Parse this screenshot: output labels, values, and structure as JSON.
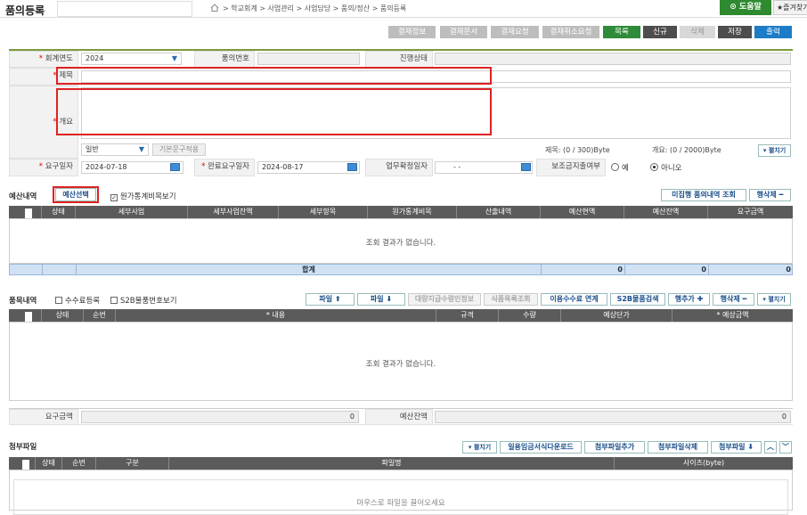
{
  "header": {
    "title": "품의등록",
    "breadcrumb": "> 학교회계 > 사업관리 > 사업담당 > 품의/정산 > 품의등록",
    "help_label": "도움말",
    "favorite_label": "즐겨찾기"
  },
  "toolbar": {
    "buttons": [
      "결재정보",
      "결재문서",
      "결재요청",
      "결재취소요청",
      "목록",
      "신규",
      "삭제",
      "저장",
      "출력"
    ]
  },
  "form": {
    "fiscal_year_label": "회계연도",
    "fiscal_year_value": "2024",
    "approval_no_label": "품의번호",
    "approval_no_value": "",
    "progress_label": "진행상태",
    "progress_value": "",
    "subject_label": "제목",
    "subject_value": "",
    "summary_label": "개요",
    "summary_value": "",
    "type_value": "일반",
    "template_btn": "기본문구적용",
    "subject_count": "제목: (0 / 300)Byte",
    "summary_count": "개요: (0 / 2000)Byte",
    "expand_label": "펼치기",
    "request_date_label": "요구일자",
    "request_date_value": "2024-07-18",
    "completion_date_label": "완료요구일자",
    "completion_date_value": "2024-08-17",
    "confirm_date_label": "업무확정일자",
    "confirm_date_value": "- -",
    "subsidy_label": "보조금지출여부",
    "subsidy_yes": "예",
    "subsidy_no": "아니오"
  },
  "budget": {
    "title": "예산내역",
    "select_btn": "예산선택",
    "stats_check": "원가통계비목보기",
    "unexec_btn": "미집행 품의내역 조회",
    "delete_row_btn": "행삭제 ━",
    "columns": [
      "상태",
      "세부사업",
      "세부사업잔액",
      "세부항목",
      "원가통계비목",
      "산출내역",
      "예산현액",
      "예산잔액",
      "요구금액"
    ],
    "empty_msg": "조회 결과가 없습니다.",
    "total_label": "합계",
    "totals": [
      "0",
      "0",
      "0"
    ]
  },
  "items": {
    "title": "품목내역",
    "fee_check": "수수료등록",
    "s2b_check": "S2B물품번호보기",
    "buttons": [
      "파일 ⬆",
      "파일 ⬇",
      "대량지급수령인정보",
      "식품목록조회",
      "이용수수료 연계",
      "S2B물품검색",
      "행추가 ✚",
      "행삭제 ━",
      "펼치기"
    ],
    "columns": [
      "상태",
      "순번",
      "* 내용",
      "규격",
      "수량",
      "예상단가",
      "* 예상금액"
    ],
    "empty_msg": "조회 결과가 없습니다."
  },
  "amounts": {
    "request_label": "요구금액",
    "request_value": "0",
    "balance_label": "예산잔액",
    "balance_value": "0"
  },
  "attach": {
    "title": "첨부파일",
    "buttons": [
      "펼치기",
      "일용임금서식다운로드",
      "첨부파일추가",
      "첨부파일삭제",
      "첨부파일 ⬇"
    ],
    "columns": [
      "상태",
      "순번",
      "구분",
      "파일명",
      "사이즈(byte)"
    ],
    "drop_msg": "마우스로 파일을 끌어오세요"
  }
}
